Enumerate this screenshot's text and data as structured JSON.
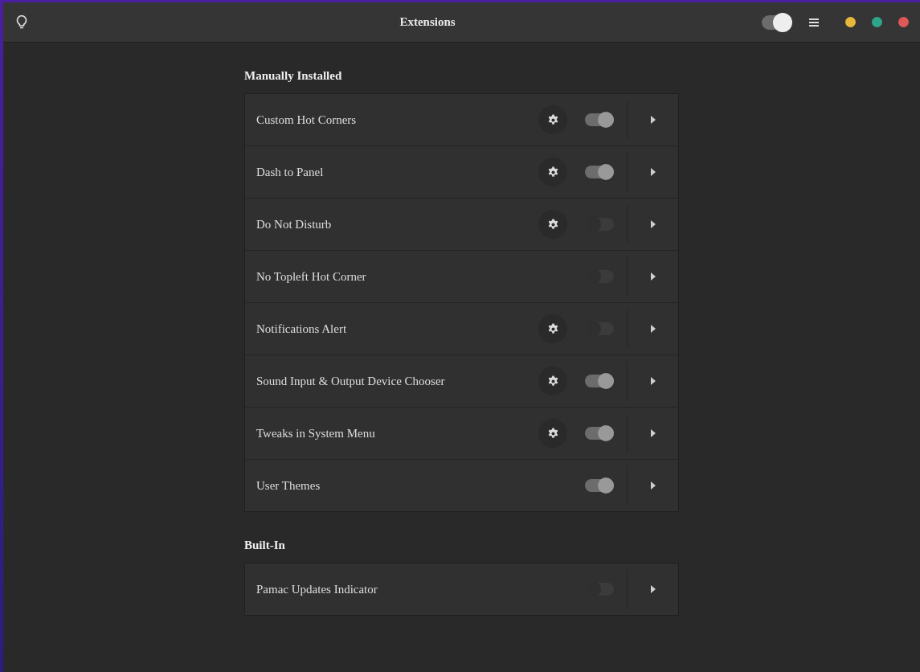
{
  "header": {
    "title": "Extensions",
    "global_switch": {
      "on": true
    }
  },
  "sections": [
    {
      "title": "Manually Installed",
      "extensions": [
        {
          "name": "Custom Hot Corners",
          "settings": true,
          "on": true
        },
        {
          "name": "Dash to Panel",
          "settings": true,
          "on": true
        },
        {
          "name": "Do Not Disturb",
          "settings": true,
          "on": false
        },
        {
          "name": "No Topleft Hot Corner",
          "settings": false,
          "on": false
        },
        {
          "name": "Notifications Alert",
          "settings": true,
          "on": false
        },
        {
          "name": "Sound Input & Output Device Chooser",
          "settings": true,
          "on": true
        },
        {
          "name": "Tweaks in System Menu",
          "settings": true,
          "on": true
        },
        {
          "name": "User Themes",
          "settings": false,
          "on": true
        }
      ]
    },
    {
      "title": "Built-In",
      "extensions": [
        {
          "name": "Pamac Updates Indicator",
          "settings": false,
          "on": false
        }
      ]
    }
  ]
}
